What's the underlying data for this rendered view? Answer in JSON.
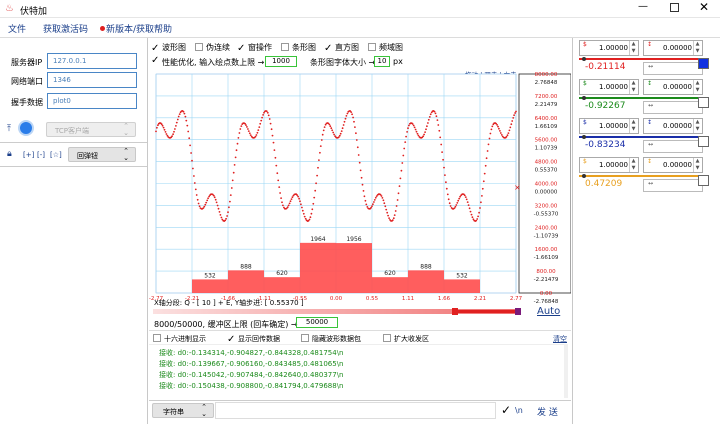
{
  "window": {
    "title": "伏特加"
  },
  "menu": {
    "file": "文件",
    "activation": "获取激活码",
    "new_version": "新版本/获取帮助"
  },
  "left": {
    "server_ip_label": "服务器IP",
    "server_ip": "127.0.0.1",
    "port_label": "网络端口",
    "port": "1346",
    "handshake_label": "握手数据",
    "handshake": "plot0",
    "mode_button": "TCP客户端",
    "bracket_a": "[+]",
    "bracket_b": "[-]",
    "bracket_c": "[☆]",
    "popup_select": "回弹钮"
  },
  "options": {
    "row1": [
      {
        "label": "波形图",
        "checked": true
      },
      {
        "label": "伪连续",
        "checked": false
      },
      {
        "label": "窗操作",
        "checked": true
      },
      {
        "label": "条形图",
        "checked": false
      },
      {
        "label": "直方图",
        "checked": true
      },
      {
        "label": "频域图",
        "checked": false
      }
    ],
    "perf_label": "性能优化, 输入绘点数上限 →",
    "perf_value": "1000",
    "bar_font_label": "条形图字体大小 →",
    "bar_font_value": "10",
    "bar_font_unit": "px",
    "links": "拖动 | 双击 | 右击"
  },
  "chart_data": {
    "type": "line",
    "title": "",
    "x_ticks": [
      "-2.77",
      "-2.21",
      "-1.66",
      "-1.11",
      "-0.55",
      "0.00",
      "0.55",
      "1.11",
      "1.66",
      "2.21",
      "2.77"
    ],
    "right_axis_red": [
      "8000.00",
      "7200.00",
      "6400.00",
      "5600.00",
      "4800.00",
      "4000.00",
      "3200.00",
      "2400.00",
      "1600.00",
      "800.00",
      "0.00"
    ],
    "right_axis_black": [
      "2.76848",
      "2.21479",
      "1.66109",
      "1.10739",
      "0.55370",
      "0.00000",
      "-0.55370",
      "-1.10739",
      "-1.66109",
      "-2.21479",
      "-2.76848"
    ],
    "histogram": {
      "categories": [
        "-2.21",
        "-1.66",
        "-1.11",
        "-0.55",
        "0.00",
        "0.55",
        "1.11",
        "1.66",
        "2.21"
      ],
      "values": [
        532,
        888,
        620,
        1964,
        1956,
        620,
        888,
        532
      ],
      "labels": [
        "532",
        "888",
        "620",
        "1964",
        "1956",
        "620",
        "888",
        "532"
      ]
    },
    "series": [
      {
        "name": "",
        "color": "#e02020"
      }
    ]
  },
  "axis_info": {
    "x_segment": "X轴分段: Q - [ 10 ] + E,  Y轴步进: [ 0.55370 ]"
  },
  "buffer": {
    "text": "8000/50000, 缓冲区上限 (回车确定) →",
    "value": "50000",
    "auto": "Auto"
  },
  "receive_opts": [
    {
      "label": "十六进制显示",
      "checked": false
    },
    {
      "label": "显示回传数据",
      "checked": true
    },
    {
      "label": "隐藏波形数据包",
      "checked": false
    },
    {
      "label": "扩大收发区",
      "checked": false
    }
  ],
  "clear": "清空",
  "log": [
    "接收: d0:-0.134314,-0.904827,-0.844328,0.481754\\n",
    "接收: d0:-0.139667,-0.906160,-0.843485,0.481065\\n",
    "接收: d0:-0.145042,-0.907484,-0.842640,0.480377\\n",
    "接收: d0:-0.150438,-0.908800,-0.841794,0.479688\\n"
  ],
  "send": {
    "format": "字符串",
    "newline": "\\n",
    "button": "发 送"
  },
  "channels": [
    {
      "a": "1.00000",
      "b": "0.00000",
      "value": "-0.21114",
      "color": "#e02020"
    },
    {
      "a": "1.00000",
      "b": "0.00000",
      "value": "-0.92267",
      "color": "#1b8a1b"
    },
    {
      "a": "1.00000",
      "b": "0.00000",
      "value": "-0.83234",
      "color": "#1a2ea8"
    },
    {
      "a": "1.00000",
      "b": "0.00000",
      "value": "0.47209",
      "color": "#e8a020"
    }
  ],
  "colors": {
    "accent": "#1a3e8a",
    "red": "#e02020",
    "green": "#1b8a1b",
    "blue": "#1a2ea8",
    "orange": "#e8a020"
  }
}
